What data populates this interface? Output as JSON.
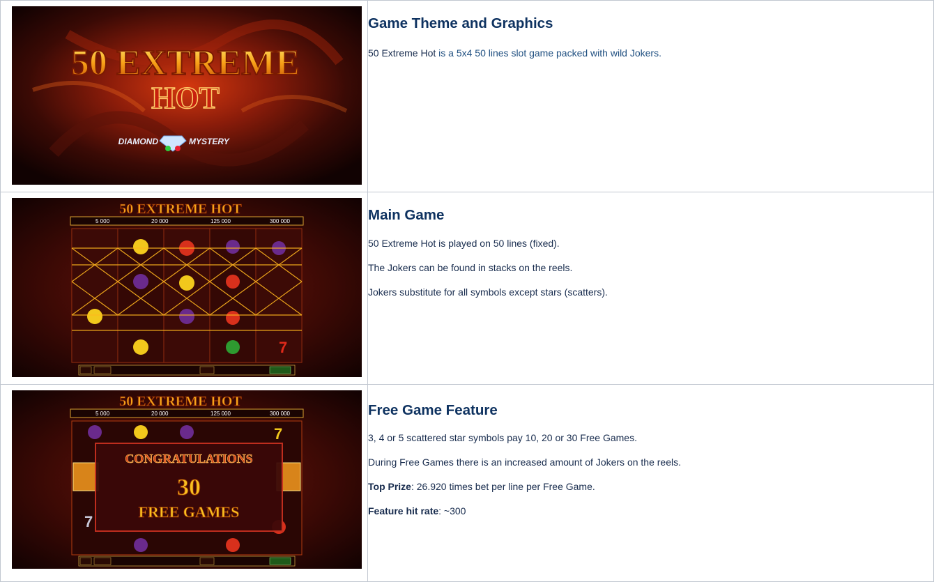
{
  "rows": [
    {
      "image_alt": "50 Extreme Hot title screen",
      "logo": {
        "line1": "50 EXTREME",
        "line2": "HOT",
        "tagline_left": "DIAMOND",
        "tagline_right": "MYSTERY"
      },
      "heading": "Game Theme and Graphics",
      "p1_prefix": "50 Extreme Hot ",
      "p1_link": " is a 5x4 50 lines slot game packed with wild Jokers."
    },
    {
      "image_alt": "Main game reels screenshot",
      "header_logo": "50 EXTREME HOT",
      "jackpots": [
        "5 000",
        "20 000",
        "125 000",
        "300 000"
      ],
      "heading": "Main Game",
      "paragraphs": [
        "50 Extreme Hot is played on 50 lines (fixed).",
        "The Jokers can be found in stacks on the reels.",
        "Jokers substitute for all symbols except stars (scatters)."
      ]
    },
    {
      "image_alt": "Free games congratulations screenshot",
      "header_logo": "50 EXTREME HOT",
      "jackpots": [
        "5 000",
        "20 000",
        "125 000",
        "300 000"
      ],
      "overlay": {
        "line1": "CONGRATULATIONS",
        "line2": "30",
        "line3": "FREE GAMES"
      },
      "heading": "Free Game Feature",
      "p1": "3, 4 or 5 scattered star symbols pay 10, 20 or 30 Free Games.",
      "p2": "During Free Games there is an increased amount of Jokers on the reels.",
      "p3_label": "Top Prize",
      "p3_text": ": 26.920 times bet per line per Free Game.",
      "p4_label": "Feature hit rate",
      "p4_text": ": ~300"
    }
  ],
  "colors": {
    "heading": "#0e3260",
    "border": "#c1c7d0",
    "link": "#205081"
  }
}
